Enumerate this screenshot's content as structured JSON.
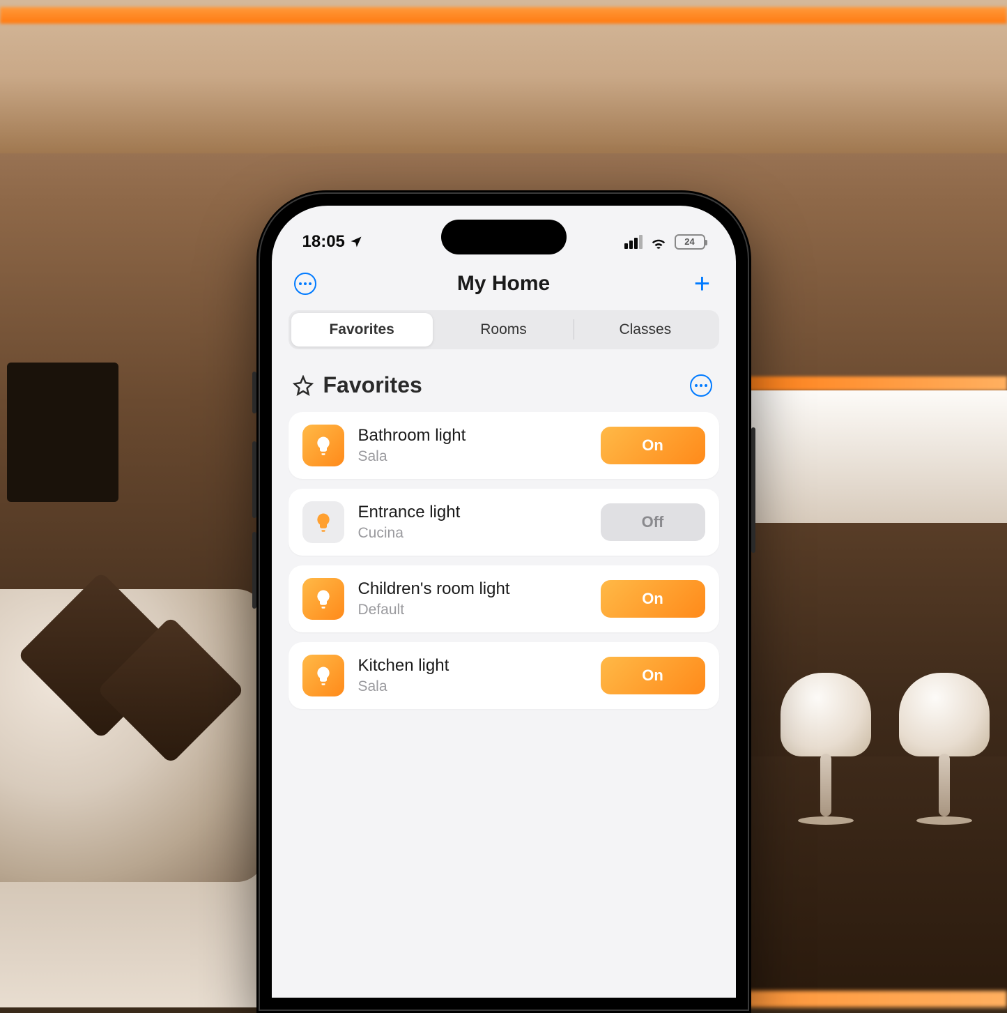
{
  "status_bar": {
    "time": "18:05",
    "battery_label": "24"
  },
  "header": {
    "title": "My Home"
  },
  "tabs": {
    "favorites": "Favorites",
    "rooms": "Rooms",
    "classes": "Classes",
    "active": "favorites"
  },
  "section": {
    "title": "Favorites"
  },
  "devices": [
    {
      "name": "Bathroom light",
      "room": "Sala",
      "state": "On",
      "on": true
    },
    {
      "name": "Entrance light",
      "room": "Cucina",
      "state": "Off",
      "on": false
    },
    {
      "name": "Children's room light",
      "room": "Default",
      "state": "On",
      "on": true
    },
    {
      "name": "Kitchen light",
      "room": "Sala",
      "state": "On",
      "on": true
    }
  ]
}
